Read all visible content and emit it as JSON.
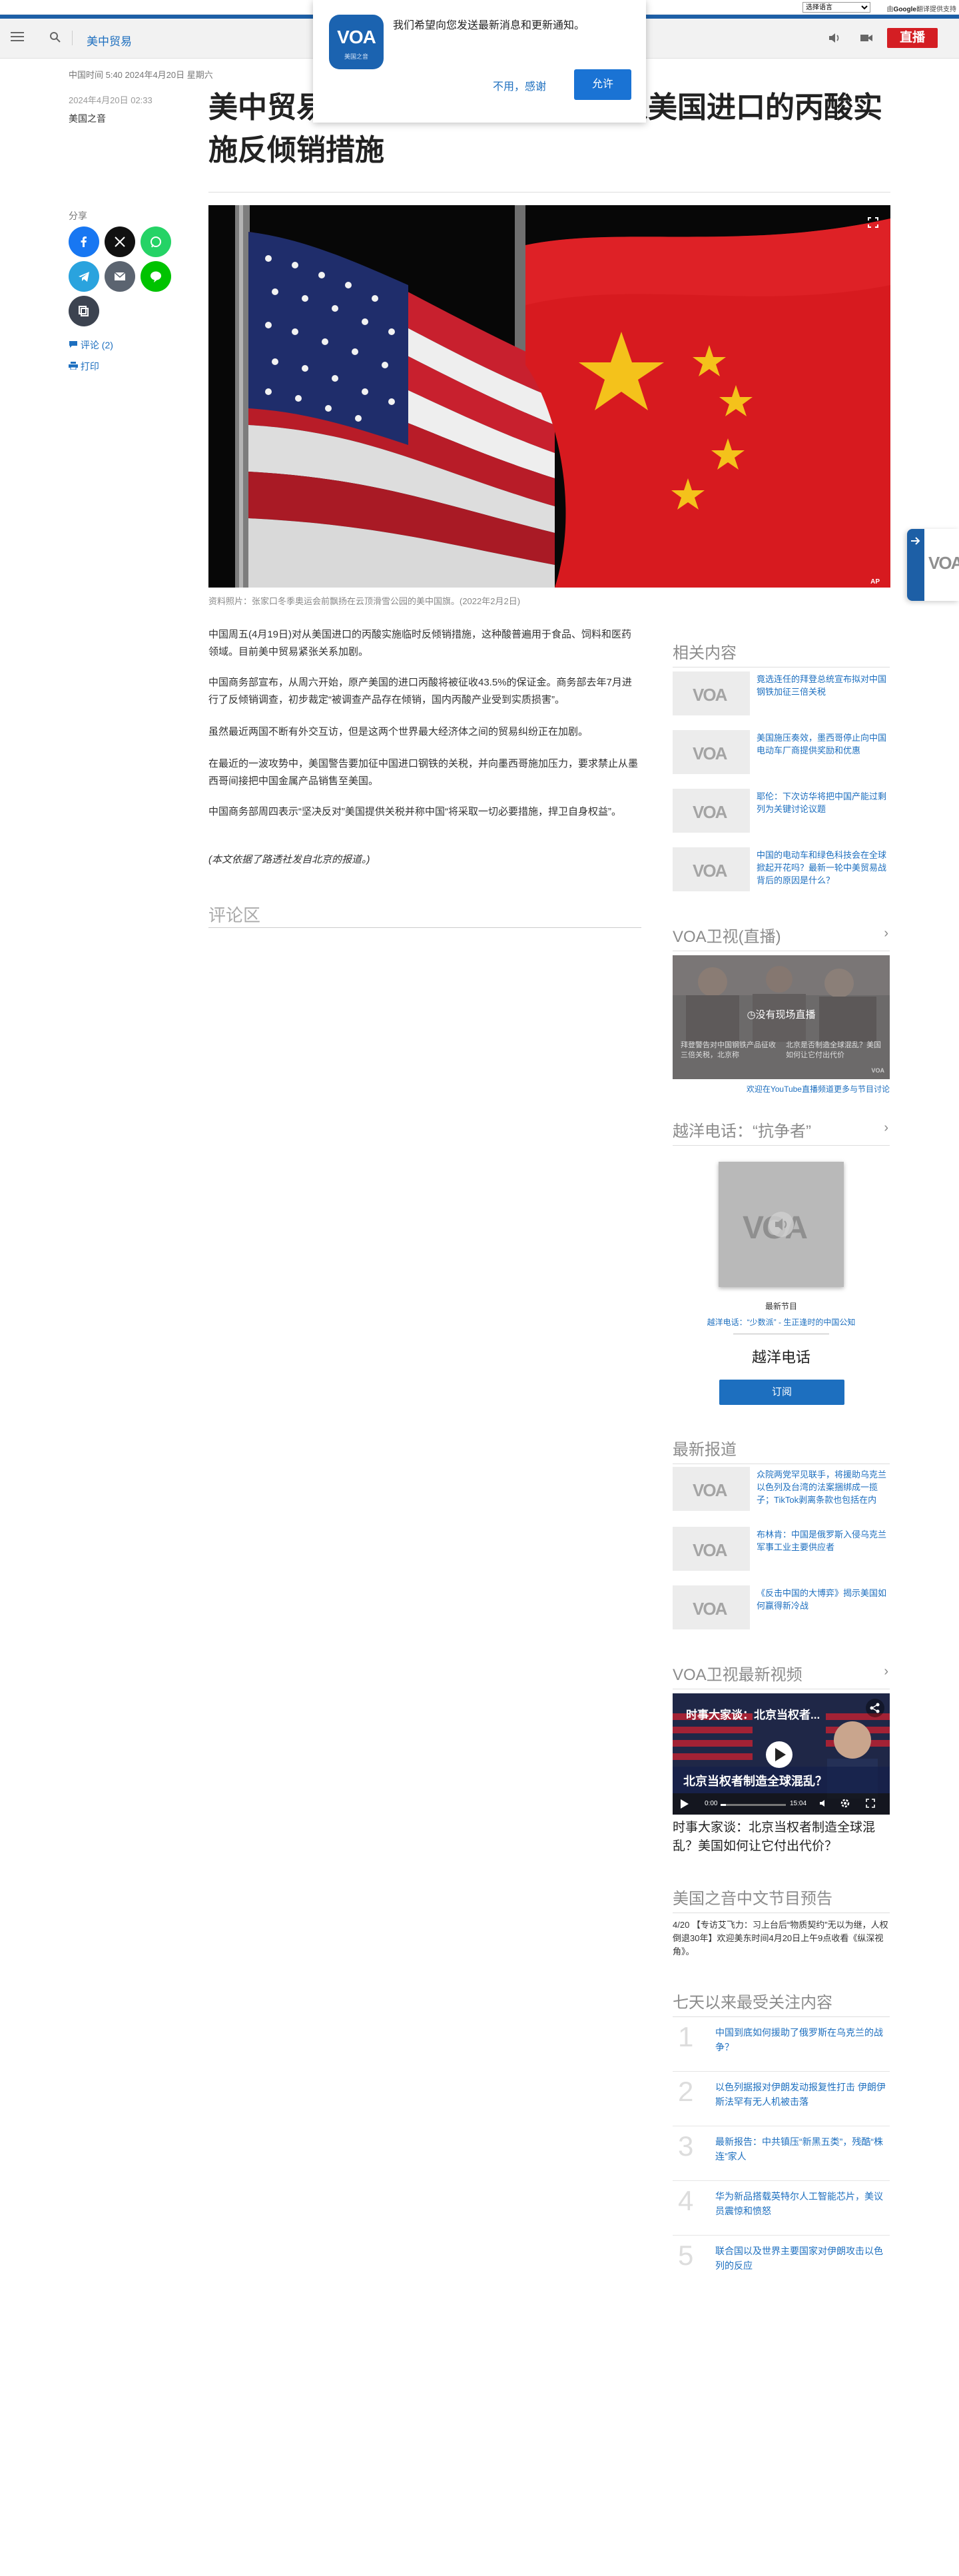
{
  "translate_bar": {
    "select_label": "选择语言",
    "powered_prefix": "由",
    "powered_google": "Google",
    "powered_suffix": "翻译提供支持"
  },
  "header": {
    "section": "美中贸易",
    "live_label": "直播"
  },
  "notification": {
    "message": "我们希望向您发送最新消息和更新通知。",
    "logo_text": "VOA",
    "logo_sub": "美国之音",
    "decline": "不用，感谢",
    "allow": "允许"
  },
  "article": {
    "time_line": "中国时间 5:40 2024年4月20日 星期六",
    "date_line": "2024年4月20日 02:33",
    "author": "美国之音",
    "title": "美中贸易摩擦加剧之际，中国对从美国进口的丙酸实施反倾销措施",
    "share_label": "分享",
    "comments_link": "评论 (2)",
    "print_link": "打印",
    "photo_credit": "AP",
    "caption": "资料照片：张家口冬季奥运会前飘扬在云顶滑雪公园的美中国旗。(2022年2月2日)",
    "paragraphs": [
      "中国周五(4月19日)对从美国进口的丙酸实施临时反倾销措施，这种酸普遍用于食品、饲料和医药领域。目前美中贸易紧张关系加剧。",
      "中国商务部宣布，从周六开始，原产美国的进口丙酸将被征收43.5%的保证金。商务部去年7月进行了反倾销调查，初步裁定“被调查产品存在倾销，国内丙酸产业受到实质损害”。",
      "虽然最近两国不断有外交互访，但是这两个世界最大经济体之间的贸易纠纷正在加剧。",
      "在最近的一波攻势中，美国警告要加征中国进口钢铁的关税，并向墨西哥施加压力，要求禁止从墨西哥间接把中国金属产品销售至美国。",
      "中国商务部周四表示“坚决反对”美国提供关税并称中国“将采取一切必要措施，捍卫自身权益”。",
      "(本文依据了路透社发自北京的报道。)"
    ],
    "comments_heading": "评论区"
  },
  "related": {
    "heading": "相关内容",
    "items": [
      {
        "logo": "VOA",
        "title": "竟选连任的拜登总统宣布拟对中国钢铁加征三倍关税"
      },
      {
        "logo": "VOA",
        "title": "美国施压奏效，墨西哥停止向中国电动车厂商提供奖励和优惠"
      },
      {
        "logo": "VOA",
        "title": "耶伦：下次访华将把中国产能过剩列为关键讨论议题"
      },
      {
        "logo": "VOA",
        "title": "中国的电动车和绿色科技会在全球掀起开花吗？最新一轮中美贸易战背后的原因是什么？"
      }
    ]
  },
  "live_tv": {
    "heading": "VOA卫视(直播)",
    "overlay": "没有现场直播",
    "caption_left": "拜登警告对中国钢铁产品征收三倍关税，北京称",
    "caption_right": "北京是否制造全球混乱？美国如何让它付出代价",
    "badge": "VOA",
    "youtube_link": "欢迎在YouTube直播频道更多与节目讨论"
  },
  "radio": {
    "heading": "越洋电话：“抗争者”",
    "latest_label": "最新节目",
    "latest_link": "越洋电话：“少数派” - 生正逢时的中国公知",
    "show_name": "越洋电话",
    "subscribe": "订阅"
  },
  "latest": {
    "heading": "最新报道",
    "items": [
      {
        "logo": "VOA",
        "title": "众院两党罕见联手，将援助乌克兰以色列及台湾的法案捆绑成一揽子；TikTok剥离条款也包括在内"
      },
      {
        "logo": "VOA",
        "title": "布林肯：中国是俄罗斯入侵乌克兰军事工业主要供应者"
      },
      {
        "logo": "VOA",
        "title": "《反击中国的大博弈》揭示美国如何赢得新冷战"
      }
    ]
  },
  "video": {
    "heading": "VOA卫视最新视频",
    "overlay_top": "时事大家谈：北京当权者...",
    "overlay_bottom": "北京当权者制造全球混乱？",
    "time_current": "0:00",
    "time_total": "15:04",
    "title": "时事大家谈：北京当权者制造全球混乱？美国如何让它付出代价？"
  },
  "schedule": {
    "heading": "美国之音中文节目预告",
    "text": "4/20 【专访艾飞力：习上台后“物质契约”无以为继，人权倒退30年】欢迎美东时间4月20日上午9点收看《纵深视角》。"
  },
  "popular": {
    "heading": "七天以来最受关注内容",
    "items": [
      {
        "num": "1",
        "title": "中国到底如何援助了俄罗斯在乌克兰的战争？"
      },
      {
        "num": "2",
        "title": "以色列据报对伊朗发动报复性打击 伊朗伊斯法罕有无人机被击落"
      },
      {
        "num": "3",
        "title": "最新报告：中共镇压“新黑五类”，残酷“株连”家人"
      },
      {
        "num": "4",
        "title": "华为新品搭载英特尔人工智能芯片，美议员震惊和愤怒"
      },
      {
        "num": "5",
        "title": "联合国以及世界主要国家对伊朗攻击以色列的反应"
      }
    ]
  },
  "float_tab": {
    "logo": "VOA"
  },
  "colors": {
    "brand_blue": "#1d6fbf",
    "live_red": "#d41e23",
    "facebook": "#1877f2",
    "x": "#111111",
    "whatsapp": "#25d366",
    "telegram": "#2aa3de",
    "email": "#5b6470",
    "line": "#00c300",
    "copy": "#3c4350"
  }
}
